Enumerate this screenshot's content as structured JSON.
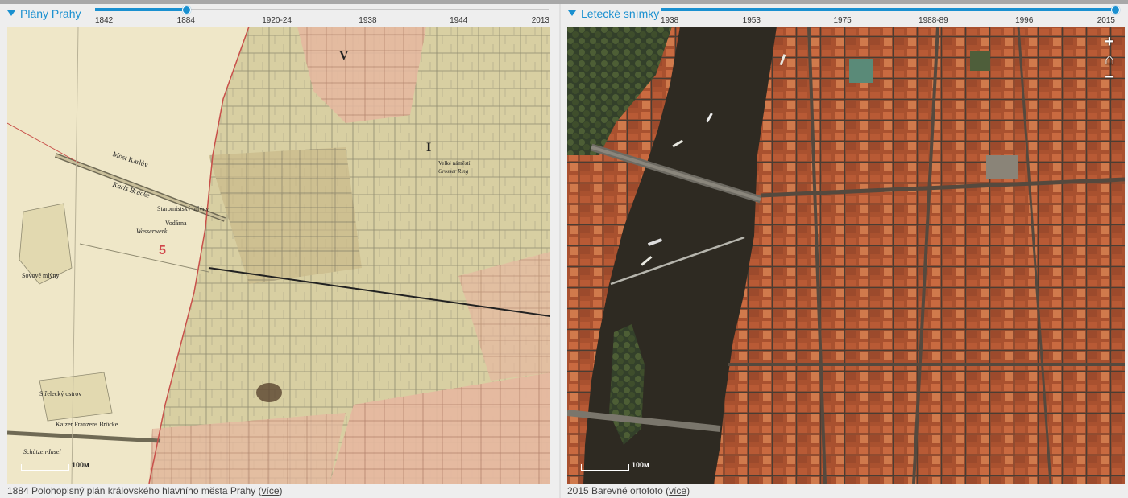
{
  "left": {
    "title": "Plány Prahy",
    "slider": {
      "ticks": [
        "1842",
        "1884",
        "1920-24",
        "1938",
        "1944",
        "2013"
      ],
      "selected": "1884",
      "selected_fraction": 0.2
    },
    "map": {
      "labels": [
        "V",
        "I",
        "5",
        "Most Karlův",
        "Karls Brücke",
        "Staromistský mlýny",
        "Vodárna",
        "Wasserwerk",
        "Sovové mlýny",
        "Střelecký ostrov",
        "Kaizer Franzens Brücke",
        "Schützen-Insel",
        "Velké náměstí",
        "Grosser Ring"
      ],
      "scale_label": "100м"
    },
    "caption": {
      "text": "1884 Polohopisný plán královského hlavního města Prahy (",
      "link": "více",
      "close": ")"
    }
  },
  "right": {
    "title": "Letecké snímky",
    "slider": {
      "ticks": [
        "1938",
        "1953",
        "1975",
        "1988-89",
        "1996",
        "2015"
      ],
      "selected": "2015",
      "selected_fraction": 1.0
    },
    "map": {
      "scale_label": "100м",
      "zoom_in": "+",
      "home": "⌂",
      "zoom_out": "−"
    },
    "caption": {
      "text": "2015 Barevné ortofoto (",
      "link": "více",
      "close": ")"
    }
  },
  "colors": {
    "accent": "#1a90d0",
    "river_old": "#efe7c8",
    "river_aerial": "#2e2a22",
    "roofs": "#b85a35"
  }
}
